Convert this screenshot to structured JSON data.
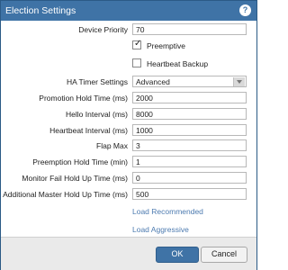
{
  "dialog": {
    "title": "Election Settings",
    "help_icon": "question-icon"
  },
  "device_priority": {
    "label": "Device Priority",
    "value": "70"
  },
  "preemptive": {
    "label": "Preemptive",
    "checked": true
  },
  "heartbeat_backup": {
    "label": "Heartbeat Backup",
    "checked": false
  },
  "ha_timer": {
    "label": "HA Timer Settings",
    "value": "Advanced"
  },
  "promotion_hold": {
    "label": "Promotion Hold Time (ms)",
    "value": "2000"
  },
  "hello_interval": {
    "label": "Hello Interval (ms)",
    "value": "8000"
  },
  "heartbeat_interval": {
    "label": "Heartbeat Interval (ms)",
    "value": "1000"
  },
  "flap_max": {
    "label": "Flap Max",
    "value": "3"
  },
  "preemption_hold": {
    "label": "Preemption Hold Time (min)",
    "value": "1"
  },
  "monitor_fail": {
    "label": "Monitor Fail Hold Up Time (ms)",
    "value": "0"
  },
  "additional_master": {
    "label": "Additional Master Hold Up Time (ms)",
    "value": "500"
  },
  "links": {
    "load_recommended": "Load Recommended",
    "load_aggressive": "Load Aggressive"
  },
  "buttons": {
    "ok": "OK",
    "cancel": "Cancel"
  }
}
